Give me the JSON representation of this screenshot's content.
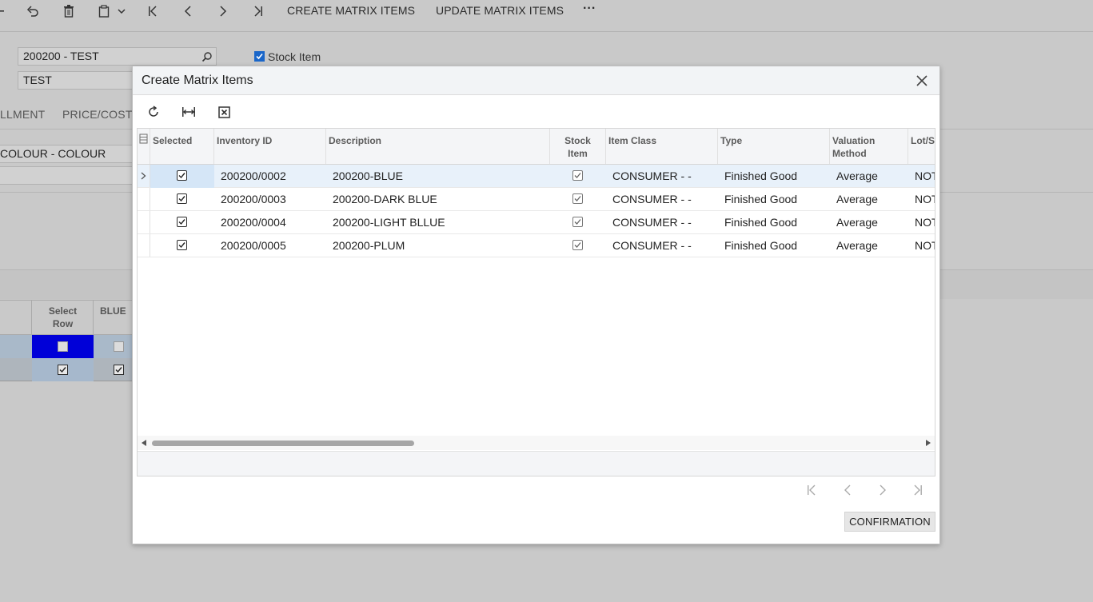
{
  "toolbar": {
    "create_matrix_items": "CREATE MATRIX ITEMS",
    "update_matrix_items": "UPDATE MATRIX ITEMS",
    "more": "···"
  },
  "form": {
    "template_id": "200200 - TEST",
    "description": "TEST",
    "stock_item_label": "Stock Item",
    "stock_item_checked": true
  },
  "tabs": {
    "partial_left": "LLMENT",
    "price_cost": "PRICE/COST"
  },
  "attributes": {
    "colour_value": "COLOUR - COLOUR"
  },
  "matrix": {
    "col_select_row": "Select\nRow",
    "col_blue": "BLUE"
  },
  "modal": {
    "title": "Create Matrix Items",
    "confirm_label": "CONFIRMATION",
    "columns": {
      "selected": "Selected",
      "inventory_id": "Inventory ID",
      "description": "Description",
      "stock_item": "Stock\nItem",
      "item_class": "Item Class",
      "type": "Type",
      "valuation_method": "Valuation\nMethod",
      "lot_serial": "Lot/S"
    },
    "rows": [
      {
        "selected": true,
        "inventory_id": "200200/0002",
        "description": "200200-BLUE",
        "stock_item": true,
        "item_class": "CONSUMER - -",
        "type": "Finished Good",
        "valuation": "Average",
        "lot": "NOT"
      },
      {
        "selected": true,
        "inventory_id": "200200/0003",
        "description": "200200-DARK BLUE",
        "stock_item": true,
        "item_class": "CONSUMER - -",
        "type": "Finished Good",
        "valuation": "Average",
        "lot": "NOT"
      },
      {
        "selected": true,
        "inventory_id": "200200/0004",
        "description": "200200-LIGHT BLLUE",
        "stock_item": true,
        "item_class": "CONSUMER - -",
        "type": "Finished Good",
        "valuation": "Average",
        "lot": "NOT"
      },
      {
        "selected": true,
        "inventory_id": "200200/0005",
        "description": "200200-PLUM",
        "stock_item": true,
        "item_class": "CONSUMER - -",
        "type": "Finished Good",
        "valuation": "Average",
        "lot": "NOT"
      }
    ]
  },
  "colors": {
    "backdrop": "#c9c9c9",
    "selected_cell": "#d5e6f7",
    "active_row": "#e8f1fa",
    "matrix_select_highlight": "#0000d8",
    "checkbox_blue": "#1a66c9"
  }
}
